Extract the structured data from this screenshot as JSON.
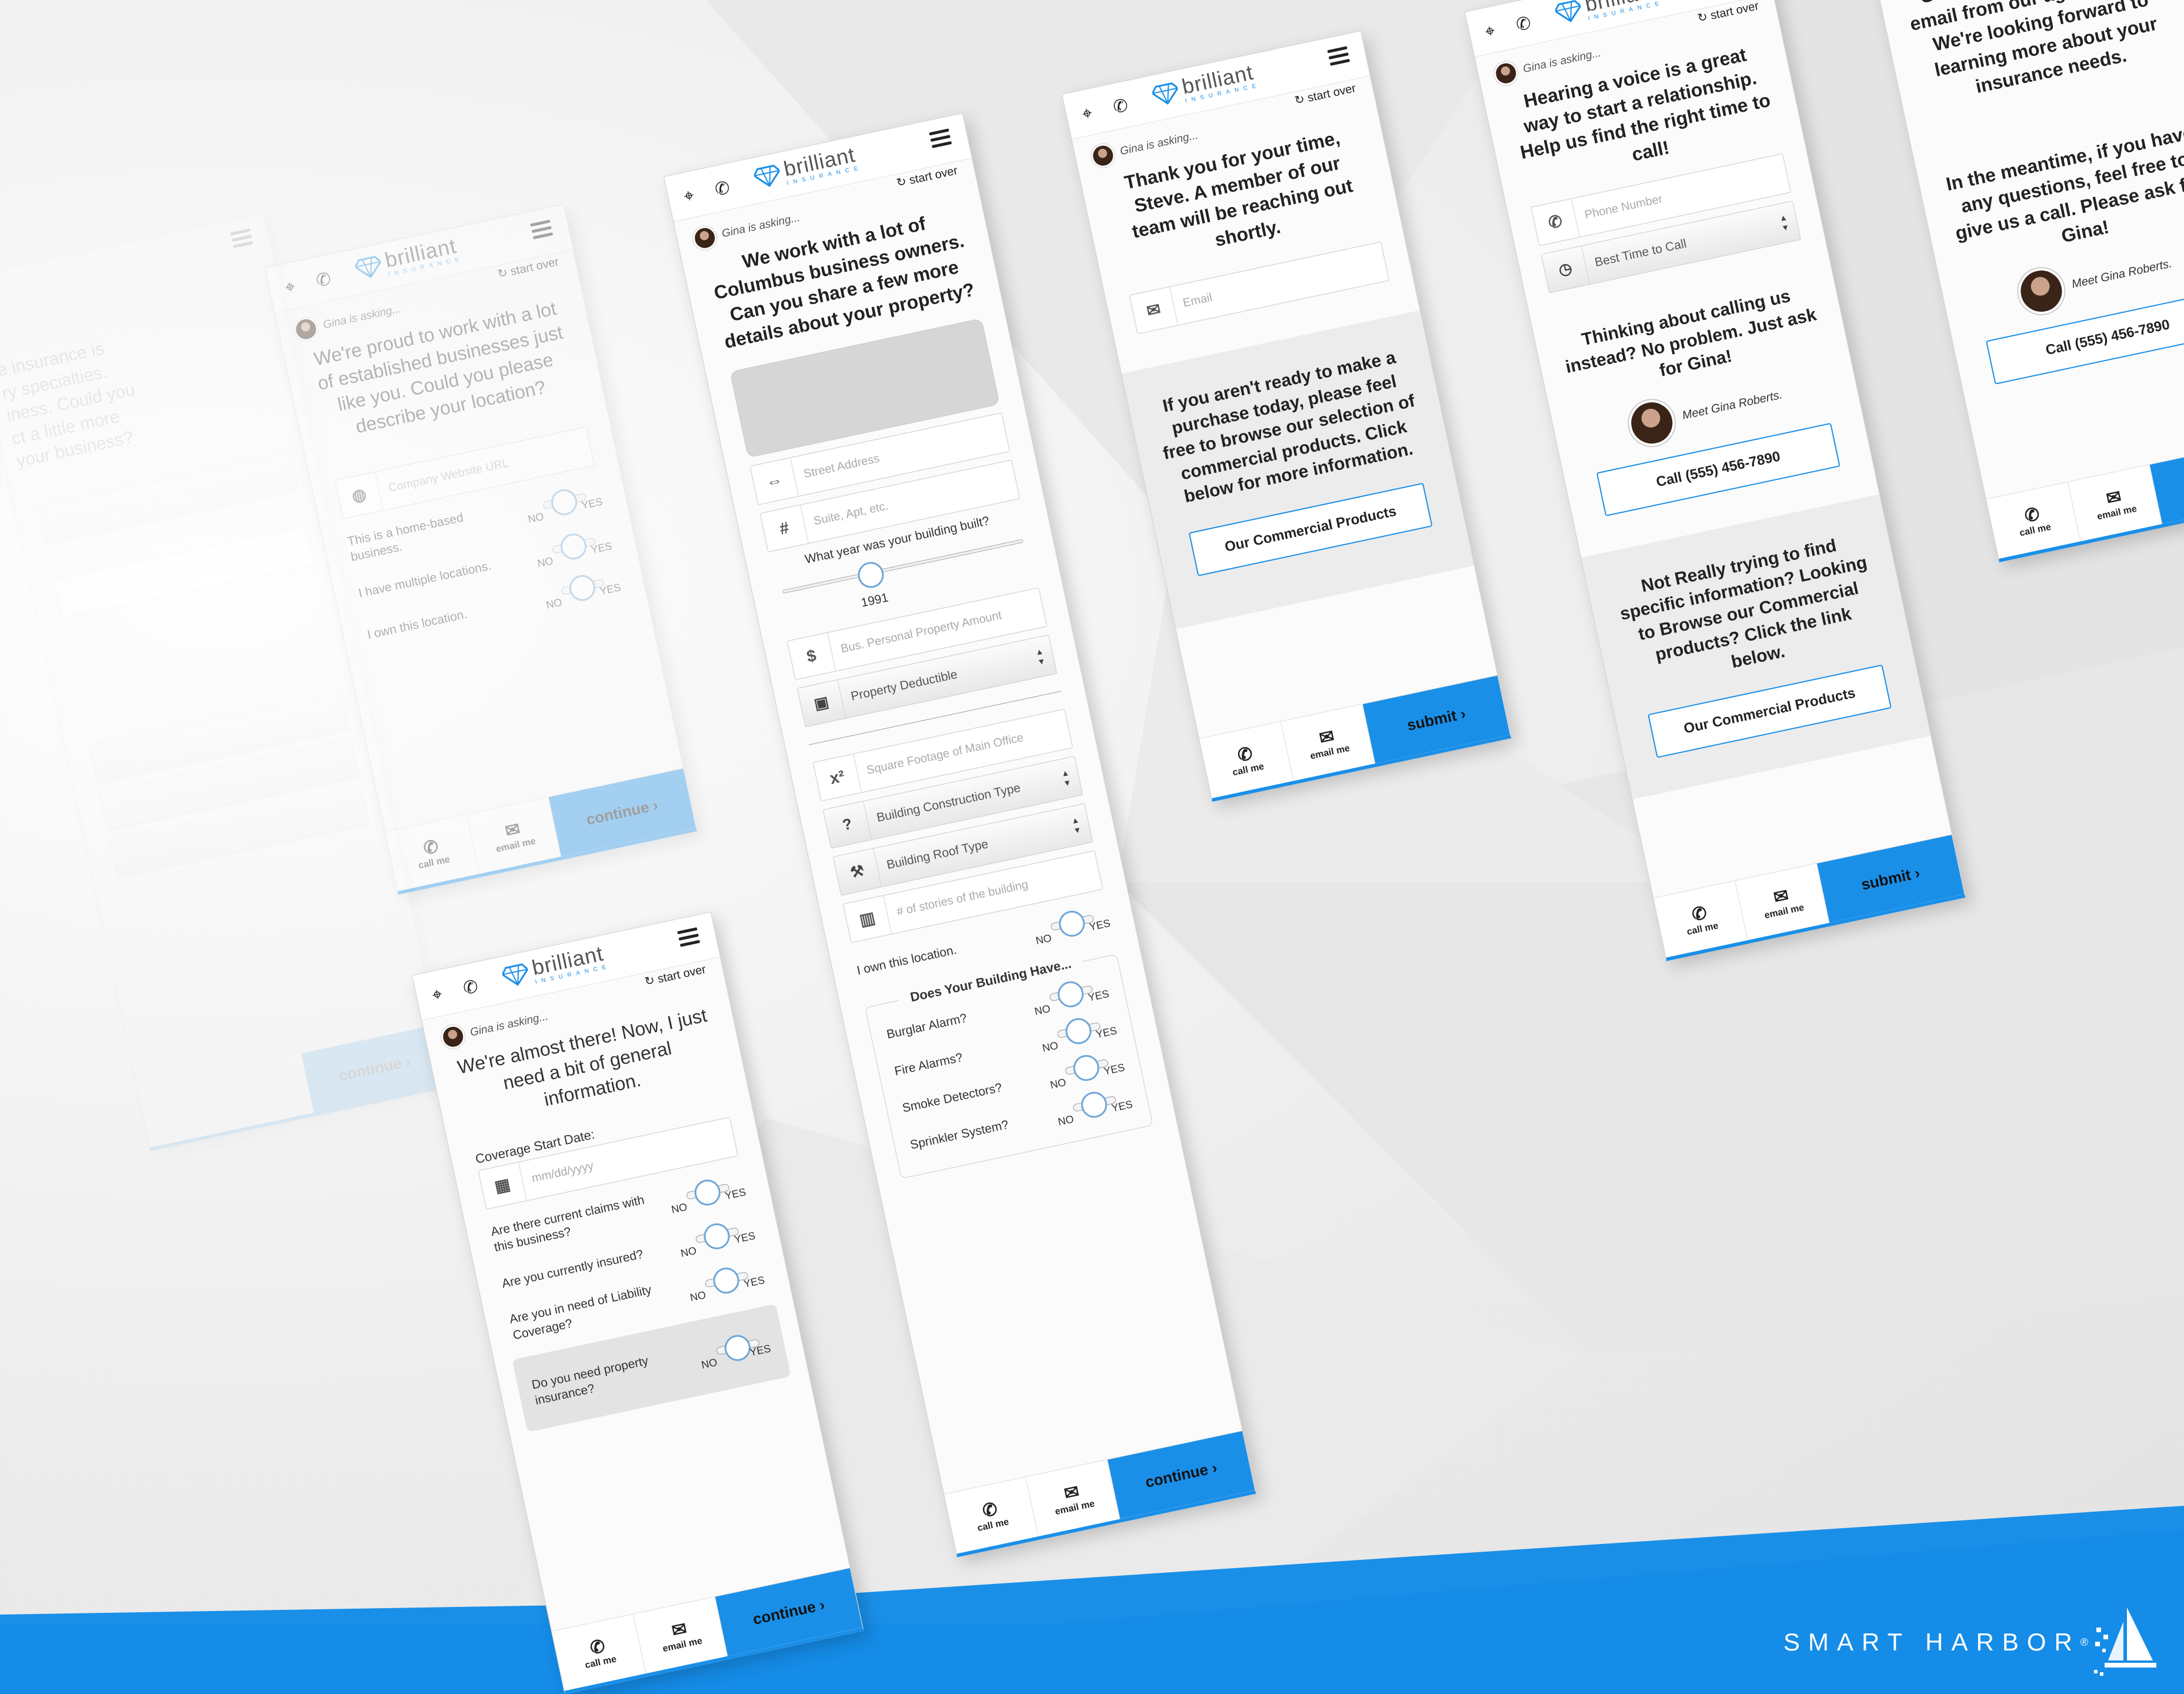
{
  "brand": {
    "name": "SMART HARBOR",
    "reg": "®",
    "colors": {
      "accent": "#1a8fe8",
      "background": "#ececec"
    }
  },
  "common": {
    "logo": "brilliant",
    "logo_sub": "INSURANCE",
    "start_over": "start over",
    "asking": "Gina is asking...",
    "call_me": "call me",
    "email_me": "email me",
    "continue": "continue",
    "submit": "submit",
    "no": "NO",
    "yes": "YES",
    "icons": {
      "pin": "map-pin-icon",
      "phone": "phone-icon",
      "menu": "hamburger-menu-icon",
      "refresh": "refresh-icon",
      "mail": "envelope-icon"
    }
  },
  "far": {
    "partial_lines": [
      "e insurance is",
      "ry specialties.",
      "iness. Could you",
      "ct a little more",
      "your business?"
    ],
    "continue": "continue"
  },
  "s1": {
    "question": "We're proud to work with a lot of established businesses just like you. Could you please describe your location?",
    "url_placeholder": "Company Website URL",
    "toggles": [
      "This is a home-based business.",
      "I have multiple locations.",
      "I own this location."
    ]
  },
  "s2": {
    "question": "We're almost there! Now, I just need a bit of general information.",
    "coverage_label": "Coverage Start Date:",
    "date_placeholder": "mm/dd/yyyy",
    "toggles": [
      "Are there current claims with this business?",
      "Are you currently insured?",
      "Are you in need of Liability Coverage?"
    ],
    "property_toggle": "Do you need property insurance?"
  },
  "s3": {
    "question": "We work with a lot of Columbus business owners. Can you share a few more details about your property?",
    "street_placeholder": "Street Address",
    "suite_placeholder": "Suite, Apt, etc.",
    "year_label": "What year was your building built?",
    "year_value": "1991",
    "year_fraction": 0.35,
    "bpp_placeholder": "Bus. Personal Property Amount",
    "deductible": "Property Deductible",
    "sqft_placeholder": "Square Footage of Main Office",
    "construction": "Building Construction Type",
    "roof": "Building Roof Type",
    "stories_placeholder": "# of stories of the building",
    "own": "I own this location.",
    "group_label": "Does Your Building Have...",
    "group_items": [
      "Burglar Alarm?",
      "Fire Alarms?",
      "Smoke Detectors?",
      "Sprinkler System?"
    ]
  },
  "s4": {
    "question": "Thank you for your time, Steve. A member of our team will be reaching out shortly.",
    "email_placeholder": "Email",
    "browse_text": "If you aren't ready to make a purchase today, please feel free to browse our selection of commercial products. Click below for more information.",
    "products_button": "Our Commercial Products"
  },
  "s5": {
    "question": "Hearing a voice is a great way to start a relationship. Help us find the right time to call!",
    "phone_placeholder": "Phone Number",
    "best_time": "Best Time to Call",
    "calling_text": "Thinking about calling us instead? No problem. Just ask for Gina!",
    "meet": "Meet Gina Roberts.",
    "call_button": "Call (555) 456-7890",
    "browse_text": "Not Really trying to find specific information? Looking to Browse our Commercial products? Click the link below.",
    "products_button": "Our Commercial Products"
  },
  "s6": {
    "text1": "Great, you will receive an email from our agency soon. We're looking forward to learning more about your insurance needs.",
    "text2": "In the meantime, if you have any questions, feel free to give us a call. Please ask for Gina!",
    "meet": "Meet Gina Roberts.",
    "call_button": "Call (555) 456-7890"
  }
}
